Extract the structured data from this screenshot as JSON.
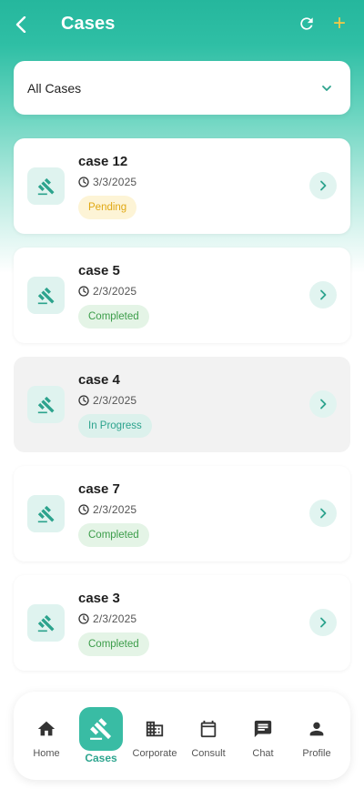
{
  "header": {
    "title": "Cases",
    "add_label": "+"
  },
  "filter": {
    "selected": "All Cases"
  },
  "colors": {
    "brand": "#2fbfa5",
    "pending": "#e0a814",
    "completed": "#3c9d4a",
    "in_progress": "#2ca38d",
    "add_accent": "#f6c945"
  },
  "cases": [
    {
      "name": "case 12",
      "date": "3/3/2025",
      "status": "Pending",
      "status_type": "pending"
    },
    {
      "name": "case 5",
      "date": "2/3/2025",
      "status": "Completed",
      "status_type": "completed"
    },
    {
      "name": "case 4",
      "date": "2/3/2025",
      "status": "In Progress",
      "status_type": "progress"
    },
    {
      "name": "case 7",
      "date": "2/3/2025",
      "status": "Completed",
      "status_type": "completed"
    },
    {
      "name": "case 3",
      "date": "2/3/2025",
      "status": "Completed",
      "status_type": "completed"
    }
  ],
  "bottom_nav": {
    "items": [
      {
        "label": "Home",
        "icon": "home-icon"
      },
      {
        "label": "Cases",
        "icon": "gavel-icon",
        "active": true
      },
      {
        "label": "Corporate",
        "icon": "building-icon"
      },
      {
        "label": "Consult",
        "icon": "calendar-icon"
      },
      {
        "label": "Chat",
        "icon": "chat-icon"
      },
      {
        "label": "Profile",
        "icon": "person-icon"
      }
    ]
  }
}
